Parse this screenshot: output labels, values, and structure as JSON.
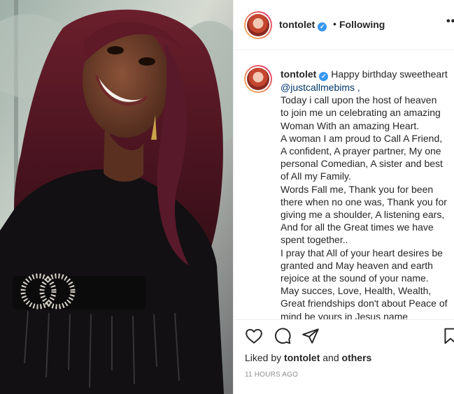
{
  "post": {
    "author": "tontolet",
    "follow_separator": "•",
    "follow_status": "Following",
    "more_label": "•••"
  },
  "caption": {
    "author": "tontolet",
    "lines": [
      "Happy birthday sweetheart",
      "@justcallmebims ,",
      "Today i call upon the host of heaven",
      "to join me un celebrating an amazing",
      "Woman With an amazing Heart.",
      "A woman I am proud to Call A Friend,",
      "A confident, A prayer partner, My one",
      "personal Comedian, A sister and best",
      "of All my Family.",
      "Words Fall me, Thank you for been",
      "there when no one was, Thank you for",
      "giving me a shoulder, A listening ears,",
      "And for all the Great times we have",
      "spent together..",
      "I pray that All of your heart desires be",
      "granted and May heaven and earth",
      "rejoice at the sound of your name.",
      "May succes, Love, Health, Wealth,",
      "Great friendships don't about Peace of",
      "mind be yours in Jesus name"
    ]
  },
  "engagement": {
    "liked_prefix": "Liked by",
    "liked_user": "tontolet",
    "liked_joiner": "and",
    "liked_suffix": "others",
    "timestamp": "11 HOURS AGO"
  },
  "icons": {
    "like": "heart-icon",
    "comment": "comment-icon",
    "share": "paper-plane-icon",
    "save": "bookmark-icon",
    "verified": "verified-badge-icon"
  },
  "colors": {
    "text": "#262626",
    "secondary": "#8e8e8e",
    "mention": "#00376b",
    "verified": "#3897f0",
    "divider": "#efefef"
  }
}
